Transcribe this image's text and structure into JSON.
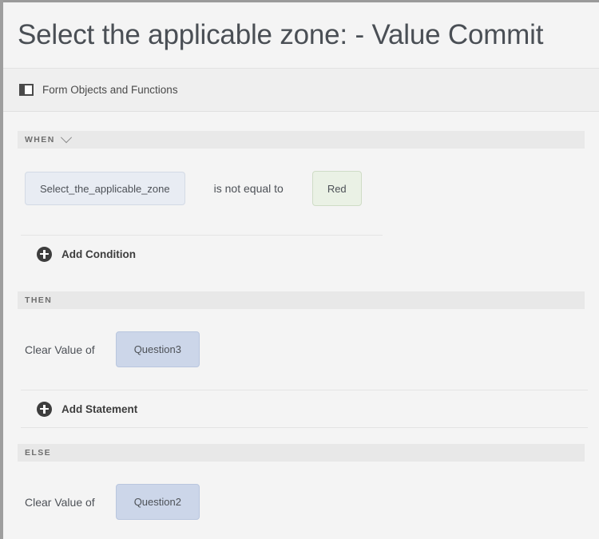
{
  "window": {
    "title": "Select the applicable zone: - Value Commit"
  },
  "toolbar": {
    "icon": "panel-layout-icon",
    "label": "Form Objects and Functions"
  },
  "rule": {
    "when": {
      "band_label": "WHEN",
      "has_chevron": true,
      "condition": {
        "object": "Select_the_applicable_zone",
        "operator": "is not equal to",
        "value": "Red"
      },
      "add_label": "Add Condition",
      "add_icon": "plus-circle-icon"
    },
    "then": {
      "band_label": "THEN",
      "statement": {
        "action": "Clear Value of",
        "target": "Question3"
      },
      "add_label": "Add Statement",
      "add_icon": "plus-circle-icon"
    },
    "else": {
      "band_label": "ELSE",
      "statement": {
        "action": "Clear Value of",
        "target": "Question2"
      }
    }
  },
  "colors": {
    "object_pill": "#e8ecf3",
    "value_pill": "#eaf1e5",
    "question_pill": "#ccd6e9",
    "band": "#e8e8e8",
    "page_bg": "#f4f4f4",
    "toolbar_bg": "#efefef"
  }
}
